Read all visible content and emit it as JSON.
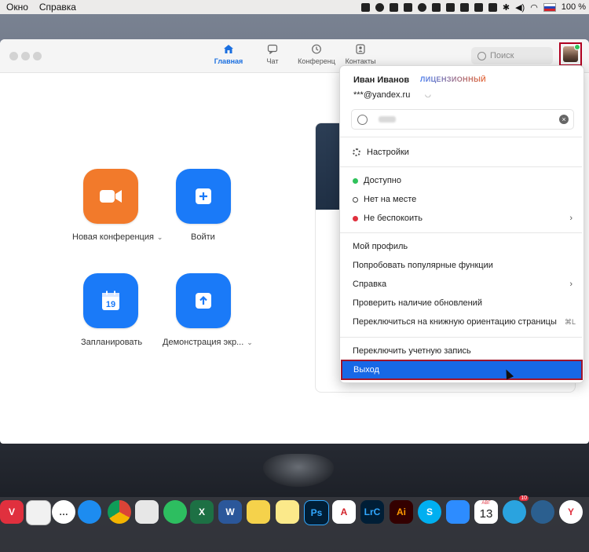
{
  "menubar": {
    "items": [
      "Окно",
      "Справка"
    ],
    "battery": "100 %"
  },
  "window": {
    "tabs": [
      {
        "label": "Главная",
        "icon": "home-icon",
        "active": true
      },
      {
        "label": "Чат",
        "icon": "chat-icon",
        "active": false
      },
      {
        "label": "Конференц",
        "icon": "clock-icon",
        "active": false
      },
      {
        "label": "Контакты",
        "icon": "contacts-icon",
        "active": false
      }
    ],
    "search_label": "Поиск"
  },
  "home": {
    "new_meeting": "Новая конференция",
    "join": "Войти",
    "schedule": "Запланировать",
    "calendar_day": "19",
    "share_screen": "Демонстрация экр..."
  },
  "profile_menu": {
    "name": "Иван Иванов",
    "license": "ЛИЦЕНЗИОННЫЙ",
    "email": "***@yandex.ru",
    "settings": "Настройки",
    "status_available": "Доступно",
    "status_away": "Нет на месте",
    "status_dnd": "Не беспокоить",
    "my_profile": "Мой профиль",
    "try_features": "Попробовать популярные функции",
    "help": "Справка",
    "check_updates": "Проверить наличие обновлений",
    "portrait": "Переключиться на книжную ориентацию страницы",
    "portrait_shortcut": "⌘L",
    "switch_account": "Переключить учетную запись",
    "logout": "Выход"
  },
  "colors": {
    "accent": "#1a7af8",
    "orange": "#f27a2b",
    "highlight_border": "#a0142a",
    "available": "#2fc25b",
    "dnd": "#e0303e"
  },
  "dock": {
    "calendar_month": "АВГ",
    "calendar_day": "13",
    "telegram_badge": "10"
  }
}
